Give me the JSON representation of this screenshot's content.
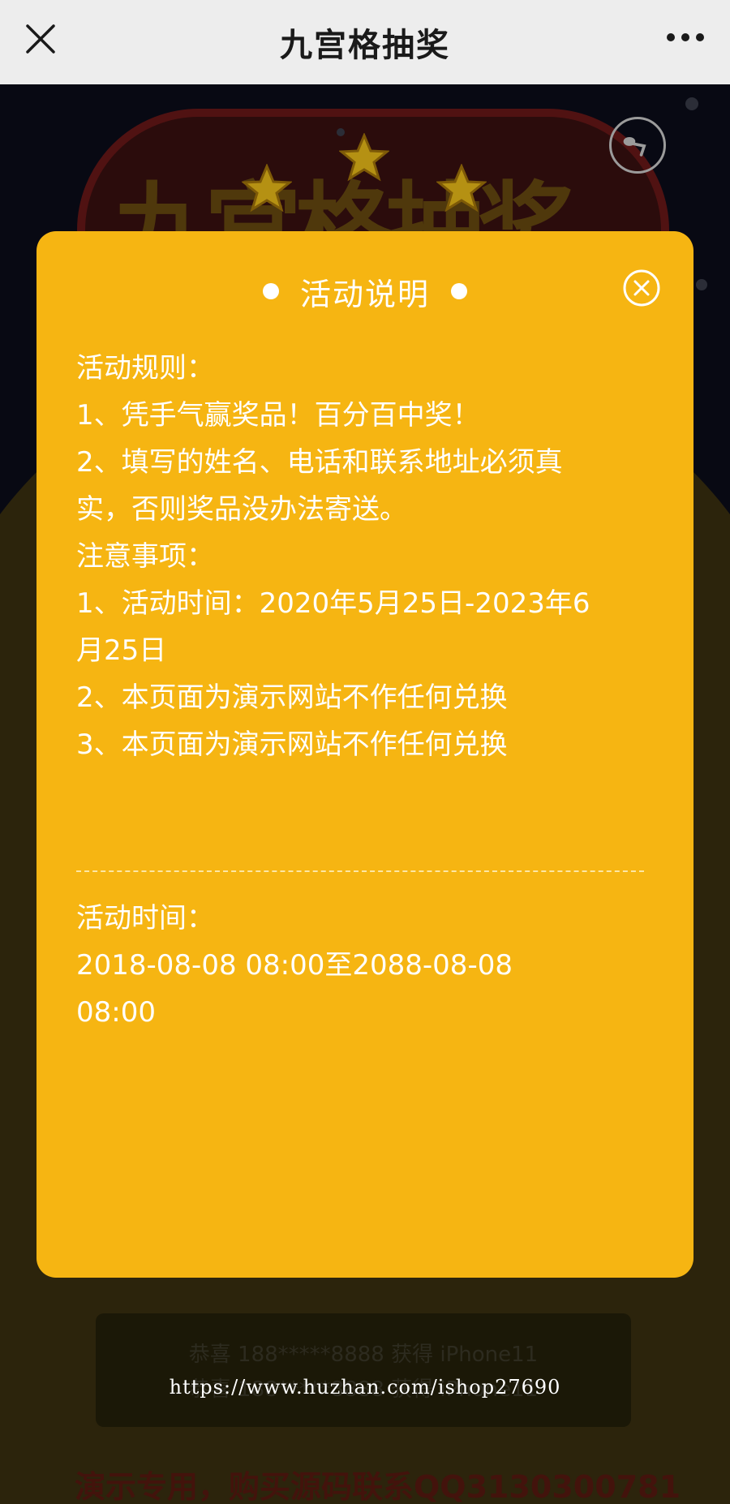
{
  "navbar": {
    "title": "九宫格抽奖",
    "close_icon": "close-icon",
    "more_icon": "more-dots-icon"
  },
  "background": {
    "banner_text": "九宫格抽奖",
    "winner_lines": [
      "恭喜 188*****8888 获得 iPhone11",
      "恭喜 188*****8888 获得 iPhone11"
    ],
    "footer_text": "演示专用，购买源码联系QQ3130300781"
  },
  "modal": {
    "title": "活动说明",
    "rules_lines": [
      "活动规则：",
      "1、凭手气赢奖品！百分百中奖！",
      "2、填写的姓名、电话和联系地址必须真",
      "实，否则奖品没办法寄送。",
      "注意事项：",
      "1、活动时间：2020年5月25日-2023年6",
      "月25日",
      "2、本页面为演示网站不作任何兑换",
      "3、本页面为演示网站不作任何兑换"
    ],
    "time_label": "活动时间：",
    "time_lines": [
      "2018-08-08 08:00至2088-08-08",
      "08:00"
    ]
  },
  "watermark": "https://www.huzhan.com/ishop27690",
  "colors": {
    "modal_bg": "#f6b512",
    "navbar_bg": "#ededed",
    "page_bg": "#0b0c1a"
  }
}
